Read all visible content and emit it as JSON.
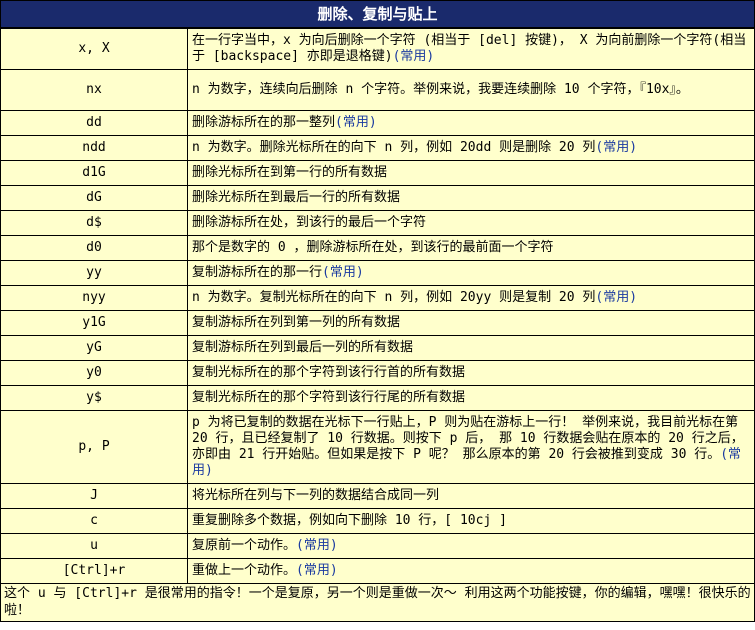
{
  "header": {
    "title": "删除、复制与贴上"
  },
  "rows": [
    {
      "key": "x, X",
      "desc": "在一行字当中，x 为向后删除一个字符 (相当于 [del] 按键)， X 为向前删除一个字符(相当于 [backspace] 亦即是退格键)",
      "common": "(常用)"
    },
    {
      "key": "nx",
      "desc": "n 为数字，连续向后删除 n 个字符。举例来说，我要连续删除 10 个字符，『10x』。",
      "common": ""
    },
    {
      "key": "dd",
      "desc": "删除游标所在的那一整列",
      "common": "(常用)"
    },
    {
      "key": "ndd",
      "desc": "n 为数字。删除光标所在的向下 n 列，例如 20dd 则是删除 20 列",
      "common": "(常用)"
    },
    {
      "key": "d1G",
      "desc": "删除光标所在到第一行的所有数据",
      "common": ""
    },
    {
      "key": "dG",
      "desc": "删除光标所在到最后一行的所有数据",
      "common": ""
    },
    {
      "key": "d$",
      "desc": "删除游标所在处，到该行的最后一个字符",
      "common": ""
    },
    {
      "key": "d0",
      "desc": "那个是数字的 0 ，删除游标所在处，到该行的最前面一个字符",
      "common": ""
    },
    {
      "key": "yy",
      "desc": "复制游标所在的那一行",
      "common": "(常用)"
    },
    {
      "key": "nyy",
      "desc": "n 为数字。复制光标所在的向下 n 列，例如 20yy 则是复制 20 列",
      "common": "(常用)"
    },
    {
      "key": "y1G",
      "desc": "复制游标所在列到第一列的所有数据",
      "common": ""
    },
    {
      "key": "yG",
      "desc": "复制游标所在列到最后一列的所有数据",
      "common": ""
    },
    {
      "key": "y0",
      "desc": "复制光标所在的那个字符到该行行首的所有数据",
      "common": ""
    },
    {
      "key": "y$",
      "desc": "复制光标所在的那个字符到该行行尾的所有数据",
      "common": ""
    },
    {
      "key": "p, P",
      "desc": "p 为将已复制的数据在光标下一行贴上，P 则为贴在游标上一行！ 举例来说，我目前光标在第 20 行，且已经复制了 10 行数据。则按下 p 后， 那 10 行数据会贴在原本的 20 行之后，亦即由 21 行开始贴。但如果是按下 P 呢？ 那么原本的第 20 行会被推到变成 30 行。",
      "common": "(常用)"
    },
    {
      "key": "J",
      "desc": "将光标所在列与下一列的数据结合成同一列",
      "common": ""
    },
    {
      "key": "c",
      "desc": "重复删除多个数据，例如向下删除 10 行，[ 10cj ]",
      "common": ""
    },
    {
      "key": "u",
      "desc": "复原前一个动作。",
      "common": "(常用)"
    },
    {
      "key": "[Ctrl]+r",
      "desc": "重做上一个动作。",
      "common": "(常用)"
    }
  ],
  "footer": {
    "text": "这个 u 与 [Ctrl]+r 是很常用的指令！一个是复原，另一个则是重做一次～ 利用这两个功能按键，你的编辑，嘿嘿！很快乐的啦！"
  }
}
